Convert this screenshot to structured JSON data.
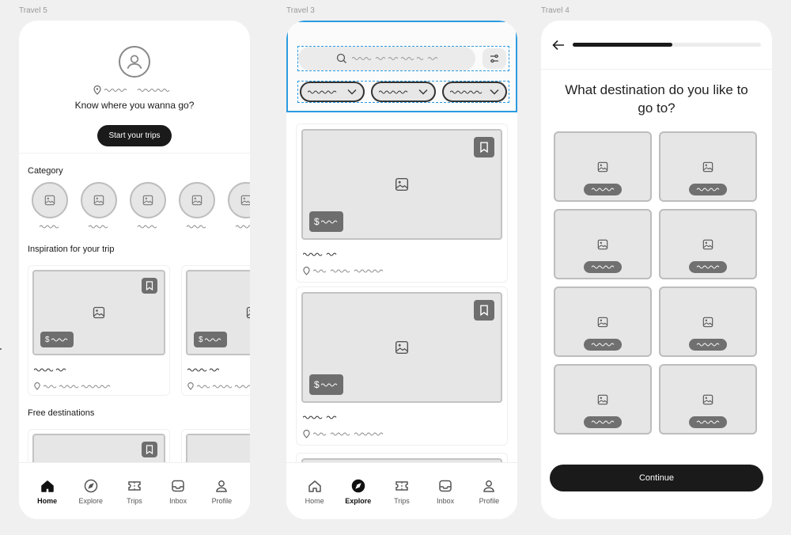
{
  "frames": [
    {
      "label": "Travel 5"
    },
    {
      "label": "Travel 3"
    },
    {
      "label": "Travel 4"
    }
  ],
  "travel5": {
    "hero_title": "Know where you wanna go?",
    "start_button": "Start your trips",
    "category_title": "Category",
    "inspiration_title": "Inspiration for your trip",
    "free_title": "Free destinations",
    "price_symbol": "$"
  },
  "travel3": {
    "price_symbol": "$"
  },
  "travel4": {
    "question": "What destination do you like to go to?",
    "continue_button": "Continue",
    "progress": 0.53
  },
  "nav_items": [
    {
      "label": "Home",
      "icon": "home-icon"
    },
    {
      "label": "Explore",
      "icon": "compass-icon"
    },
    {
      "label": "Trips",
      "icon": "ticket-icon"
    },
    {
      "label": "Inbox",
      "icon": "inbox-icon"
    },
    {
      "label": "Profile",
      "icon": "user-icon"
    }
  ],
  "active_nav": {
    "travel5": "Home",
    "travel3": "Explore"
  },
  "colors": {
    "accent": "#1a1a1a",
    "selection": "#2b9be0",
    "placeholder": "#e6e6e6"
  }
}
